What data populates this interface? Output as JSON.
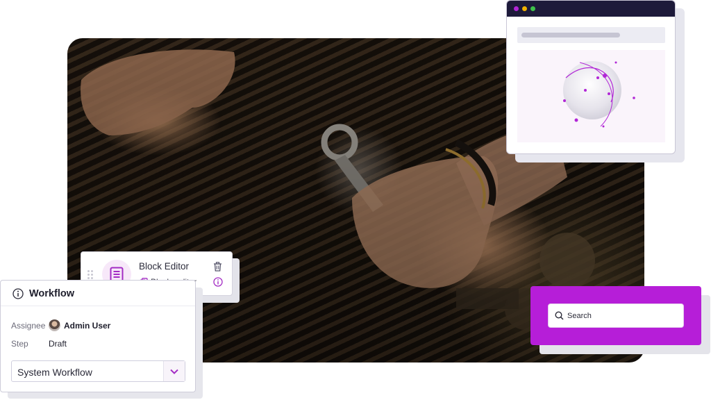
{
  "block_editor": {
    "title": "Block Editor",
    "type_name": "Block_editor",
    "accent": "#a32cc4"
  },
  "workflow": {
    "title": "Workflow",
    "assignee_label": "Assignee",
    "assignee_value": "Admin User",
    "step_label": "Step",
    "step_value": "Draft",
    "workflow_select": "System Workflow"
  },
  "search": {
    "placeholder": "Search",
    "card_color": "#b61ed8"
  },
  "browser_mock": {
    "titlebar_color": "#1d1a3a",
    "dots": [
      "#b126d6",
      "#f2b200",
      "#3dc24a"
    ]
  },
  "hero": {
    "subject": "mechanic hands with wrench over engine"
  }
}
